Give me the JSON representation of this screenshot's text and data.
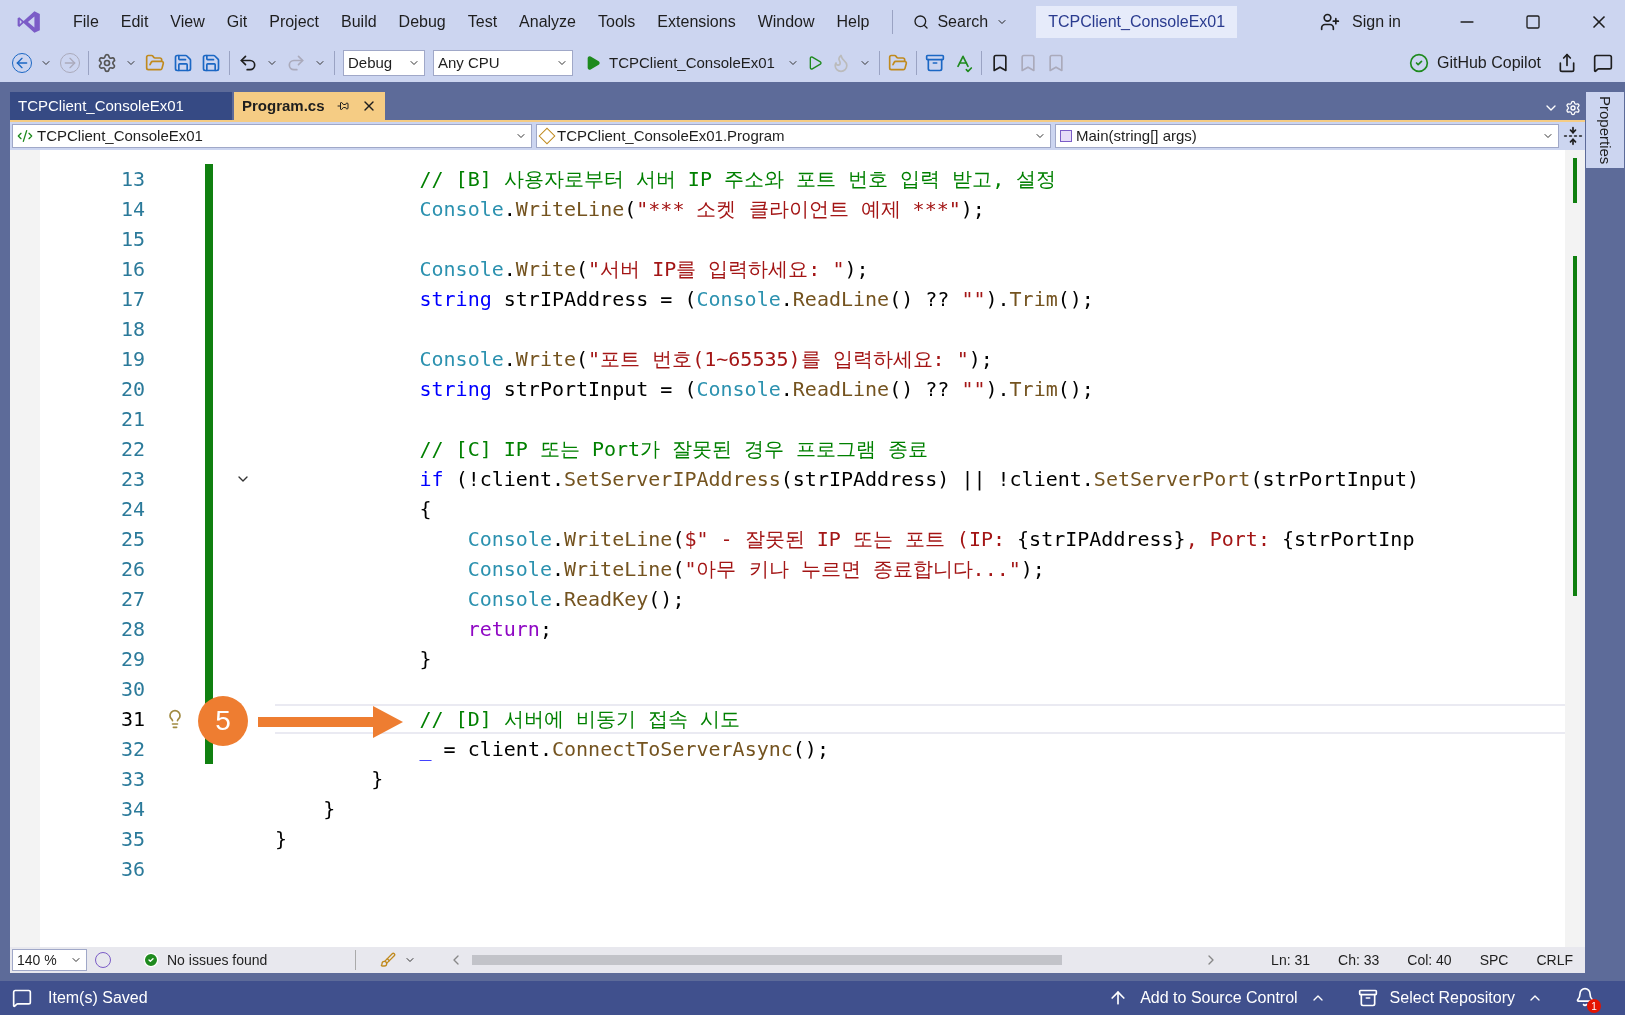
{
  "menu": [
    "File",
    "Edit",
    "View",
    "Git",
    "Project",
    "Build",
    "Debug",
    "Test",
    "Analyze",
    "Tools",
    "Extensions",
    "Window",
    "Help"
  ],
  "search": {
    "label": "Search"
  },
  "solution_title": "TCPClient_ConsoleEx01",
  "account": {
    "label": "Sign in"
  },
  "toolbar": {
    "configuration": "Debug",
    "platform": "Any CPU",
    "start_target": "TCPClient_ConsoleEx01",
    "copilot": "GitHub Copilot"
  },
  "tabs": [
    {
      "label": "TCPClient_ConsoleEx01",
      "selected": false
    },
    {
      "label": "Program.cs",
      "selected": true
    }
  ],
  "navigation": {
    "project": "TCPClient_ConsoleEx01",
    "type": "TCPClient_ConsoleEx01.Program",
    "member": "Main(string[] args)"
  },
  "side_panel": {
    "title": "Properties"
  },
  "editor": {
    "lines": [
      {
        "number": "13",
        "current": false,
        "foldable": false,
        "lightbulb": false,
        "tokens": [
          {
            "text": "            // [B] 사용자로부터 서버 IP 주소와 포트 번호 입력 받고, 설정",
            "kind": "comment"
          }
        ]
      },
      {
        "number": "14",
        "current": false,
        "foldable": false,
        "lightbulb": false,
        "tokens": [
          {
            "text": "            Console",
            "kind": "type"
          },
          {
            "text": ".",
            "kind": "plain"
          },
          {
            "text": "WriteLine",
            "kind": "method"
          },
          {
            "text": "(",
            "kind": "plain"
          },
          {
            "text": "\"*** 소켓 클라이언트 예제 ***\"",
            "kind": "string"
          },
          {
            "text": ");",
            "kind": "plain"
          }
        ]
      },
      {
        "number": "15",
        "current": false,
        "foldable": false,
        "lightbulb": false
      },
      {
        "number": "16",
        "current": false,
        "foldable": false,
        "lightbulb": false,
        "tokens": [
          {
            "text": "            Console",
            "kind": "type"
          },
          {
            "text": ".",
            "kind": "plain"
          },
          {
            "text": "Write",
            "kind": "method"
          },
          {
            "text": "(",
            "kind": "plain"
          },
          {
            "text": "\"서버 IP를 입력하세요: \"",
            "kind": "string"
          },
          {
            "text": ");",
            "kind": "plain"
          }
        ]
      },
      {
        "number": "17",
        "current": false,
        "foldable": false,
        "lightbulb": false,
        "tokens": [
          {
            "text": "            string",
            "kind": "keyword"
          },
          {
            "text": " strIPAddress = (",
            "kind": "plain"
          },
          {
            "text": "Console",
            "kind": "type"
          },
          {
            "text": ".",
            "kind": "plain"
          },
          {
            "text": "ReadLine",
            "kind": "method"
          },
          {
            "text": "() ?? ",
            "kind": "plain"
          },
          {
            "text": "\"\"",
            "kind": "string"
          },
          {
            "text": ").",
            "kind": "plain"
          },
          {
            "text": "Trim",
            "kind": "method"
          },
          {
            "text": "();",
            "kind": "plain"
          }
        ]
      },
      {
        "number": "18",
        "current": false,
        "foldable": false,
        "lightbulb": false
      },
      {
        "number": "19",
        "current": false,
        "foldable": false,
        "lightbulb": false,
        "tokens": [
          {
            "text": "            Console",
            "kind": "type"
          },
          {
            "text": ".",
            "kind": "plain"
          },
          {
            "text": "Write",
            "kind": "method"
          },
          {
            "text": "(",
            "kind": "plain"
          },
          {
            "text": "\"포트 번호(1~65535)를 입력하세요: \"",
            "kind": "string"
          },
          {
            "text": ");",
            "kind": "plain"
          }
        ]
      },
      {
        "number": "20",
        "current": false,
        "foldable": false,
        "lightbulb": false,
        "tokens": [
          {
            "text": "            string",
            "kind": "keyword"
          },
          {
            "text": " strPortInput = (",
            "kind": "plain"
          },
          {
            "text": "Console",
            "kind": "type"
          },
          {
            "text": ".",
            "kind": "plain"
          },
          {
            "text": "ReadLine",
            "kind": "method"
          },
          {
            "text": "() ?? ",
            "kind": "plain"
          },
          {
            "text": "\"\"",
            "kind": "string"
          },
          {
            "text": ").",
            "kind": "plain"
          },
          {
            "text": "Trim",
            "kind": "method"
          },
          {
            "text": "();",
            "kind": "plain"
          }
        ]
      },
      {
        "number": "21",
        "current": false,
        "foldable": false,
        "lightbulb": false
      },
      {
        "number": "22",
        "current": false,
        "foldable": false,
        "lightbulb": false,
        "tokens": [
          {
            "text": "            // [C] IP 또는 Port가 잘못된 경우 프로그램 종료",
            "kind": "comment"
          }
        ]
      },
      {
        "number": "23",
        "current": false,
        "foldable": true,
        "lightbulb": false,
        "tokens": [
          {
            "text": "            if",
            "kind": "keyword"
          },
          {
            "text": " (!client.",
            "kind": "plain"
          },
          {
            "text": "SetServerIPAddress",
            "kind": "method"
          },
          {
            "text": "(strIPAddress) || !client.",
            "kind": "plain"
          },
          {
            "text": "SetServerPort",
            "kind": "method"
          },
          {
            "text": "(strPortInput)",
            "kind": "plain"
          }
        ]
      },
      {
        "number": "24",
        "current": false,
        "foldable": false,
        "lightbulb": false,
        "tokens": [
          {
            "text": "            {",
            "kind": "plain"
          }
        ]
      },
      {
        "number": "25",
        "current": false,
        "foldable": false,
        "lightbulb": false,
        "tokens": [
          {
            "text": "                Console",
            "kind": "type"
          },
          {
            "text": ".",
            "kind": "plain"
          },
          {
            "text": "WriteLine",
            "kind": "method"
          },
          {
            "text": "(",
            "kind": "plain"
          },
          {
            "text": "$\" - 잘못된 IP 또는 포트 (IP: ",
            "kind": "string"
          },
          {
            "text": "{strIPAddress}",
            "kind": "plain"
          },
          {
            "text": ", Port: ",
            "kind": "string"
          },
          {
            "text": "{strPortInp",
            "kind": "plain"
          }
        ]
      },
      {
        "number": "26",
        "current": false,
        "foldable": false,
        "lightbulb": false,
        "tokens": [
          {
            "text": "                Console",
            "kind": "type"
          },
          {
            "text": ".",
            "kind": "plain"
          },
          {
            "text": "WriteLine",
            "kind": "method"
          },
          {
            "text": "(",
            "kind": "plain"
          },
          {
            "text": "\"아무 키나 누르면 종료합니다...\"",
            "kind": "string"
          },
          {
            "text": ");",
            "kind": "plain"
          }
        ]
      },
      {
        "number": "27",
        "current": false,
        "foldable": false,
        "lightbulb": false,
        "tokens": [
          {
            "text": "                Console",
            "kind": "type"
          },
          {
            "text": ".",
            "kind": "plain"
          },
          {
            "text": "ReadKey",
            "kind": "method"
          },
          {
            "text": "();",
            "kind": "plain"
          }
        ]
      },
      {
        "number": "28",
        "current": false,
        "foldable": false,
        "lightbulb": false,
        "tokens": [
          {
            "text": "                return",
            "kind": "control"
          },
          {
            "text": ";",
            "kind": "plain"
          }
        ]
      },
      {
        "number": "29",
        "current": false,
        "foldable": false,
        "lightbulb": false,
        "tokens": [
          {
            "text": "            }",
            "kind": "plain"
          }
        ]
      },
      {
        "number": "30",
        "current": false,
        "foldable": false,
        "lightbulb": false
      },
      {
        "number": "31",
        "current": true,
        "foldable": false,
        "lightbulb": true,
        "tokens": [
          {
            "text": "            // [D] 서버에 비동기 접속 시도",
            "kind": "comment"
          }
        ]
      },
      {
        "number": "32",
        "current": false,
        "foldable": false,
        "lightbulb": false,
        "tokens": [
          {
            "text": "            _",
            "kind": "keyword"
          },
          {
            "text": " = client.",
            "kind": "plain"
          },
          {
            "text": "ConnectToServerAsync",
            "kind": "method"
          },
          {
            "text": "();",
            "kind": "plain"
          }
        ]
      },
      {
        "number": "33",
        "current": false,
        "foldable": false,
        "lightbulb": false,
        "tokens": [
          {
            "text": "        }",
            "kind": "plain"
          }
        ]
      },
      {
        "number": "34",
        "current": false,
        "foldable": false,
        "lightbulb": false,
        "tokens": [
          {
            "text": "    }",
            "kind": "plain"
          }
        ]
      },
      {
        "number": "35",
        "current": false,
        "foldable": false,
        "lightbulb": false,
        "tokens": [
          {
            "text": "}",
            "kind": "plain"
          }
        ]
      },
      {
        "number": "36",
        "current": false,
        "foldable": false,
        "lightbulb": false
      }
    ]
  },
  "annotation": {
    "label": "5"
  },
  "editor_status": {
    "zoom": "140 %",
    "issues": "No issues found",
    "position": [
      "Ln: 31",
      "Ch: 33",
      "Col: 40",
      "SPC",
      "CRLF"
    ]
  },
  "status_bar": {
    "message": "Item(s) Saved",
    "source_control": "Add to Source Control",
    "repository": "Select Repository",
    "notifications": "1"
  }
}
